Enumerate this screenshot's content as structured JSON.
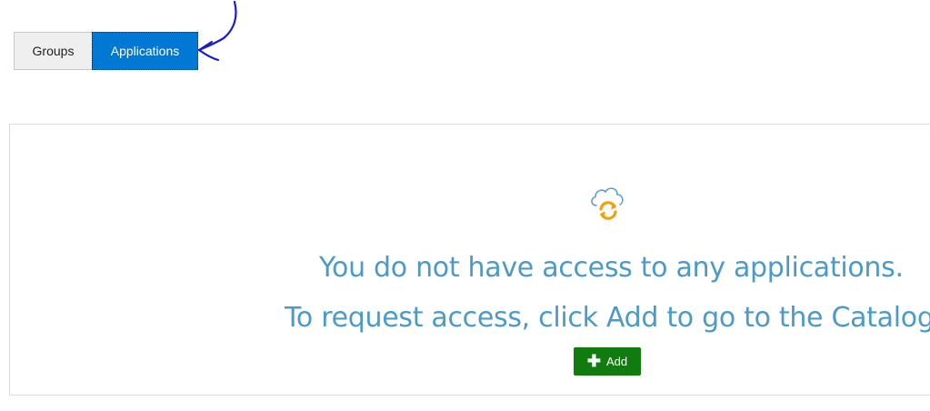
{
  "tabs": {
    "groups": "Groups",
    "applications": "Applications"
  },
  "empty_state": {
    "icon": "cloud-sync-icon",
    "line1": "You do not have access to any applications.",
    "line2": "To request access, click Add to go to the Catalog",
    "add_button": {
      "icon": "plus-icon",
      "label": "Add"
    }
  },
  "colors": {
    "applications_tab": "#0078d4",
    "message_text": "#4a9bc7",
    "add_button": "#107c10",
    "annotation_arrow": "#1a1ad6"
  }
}
